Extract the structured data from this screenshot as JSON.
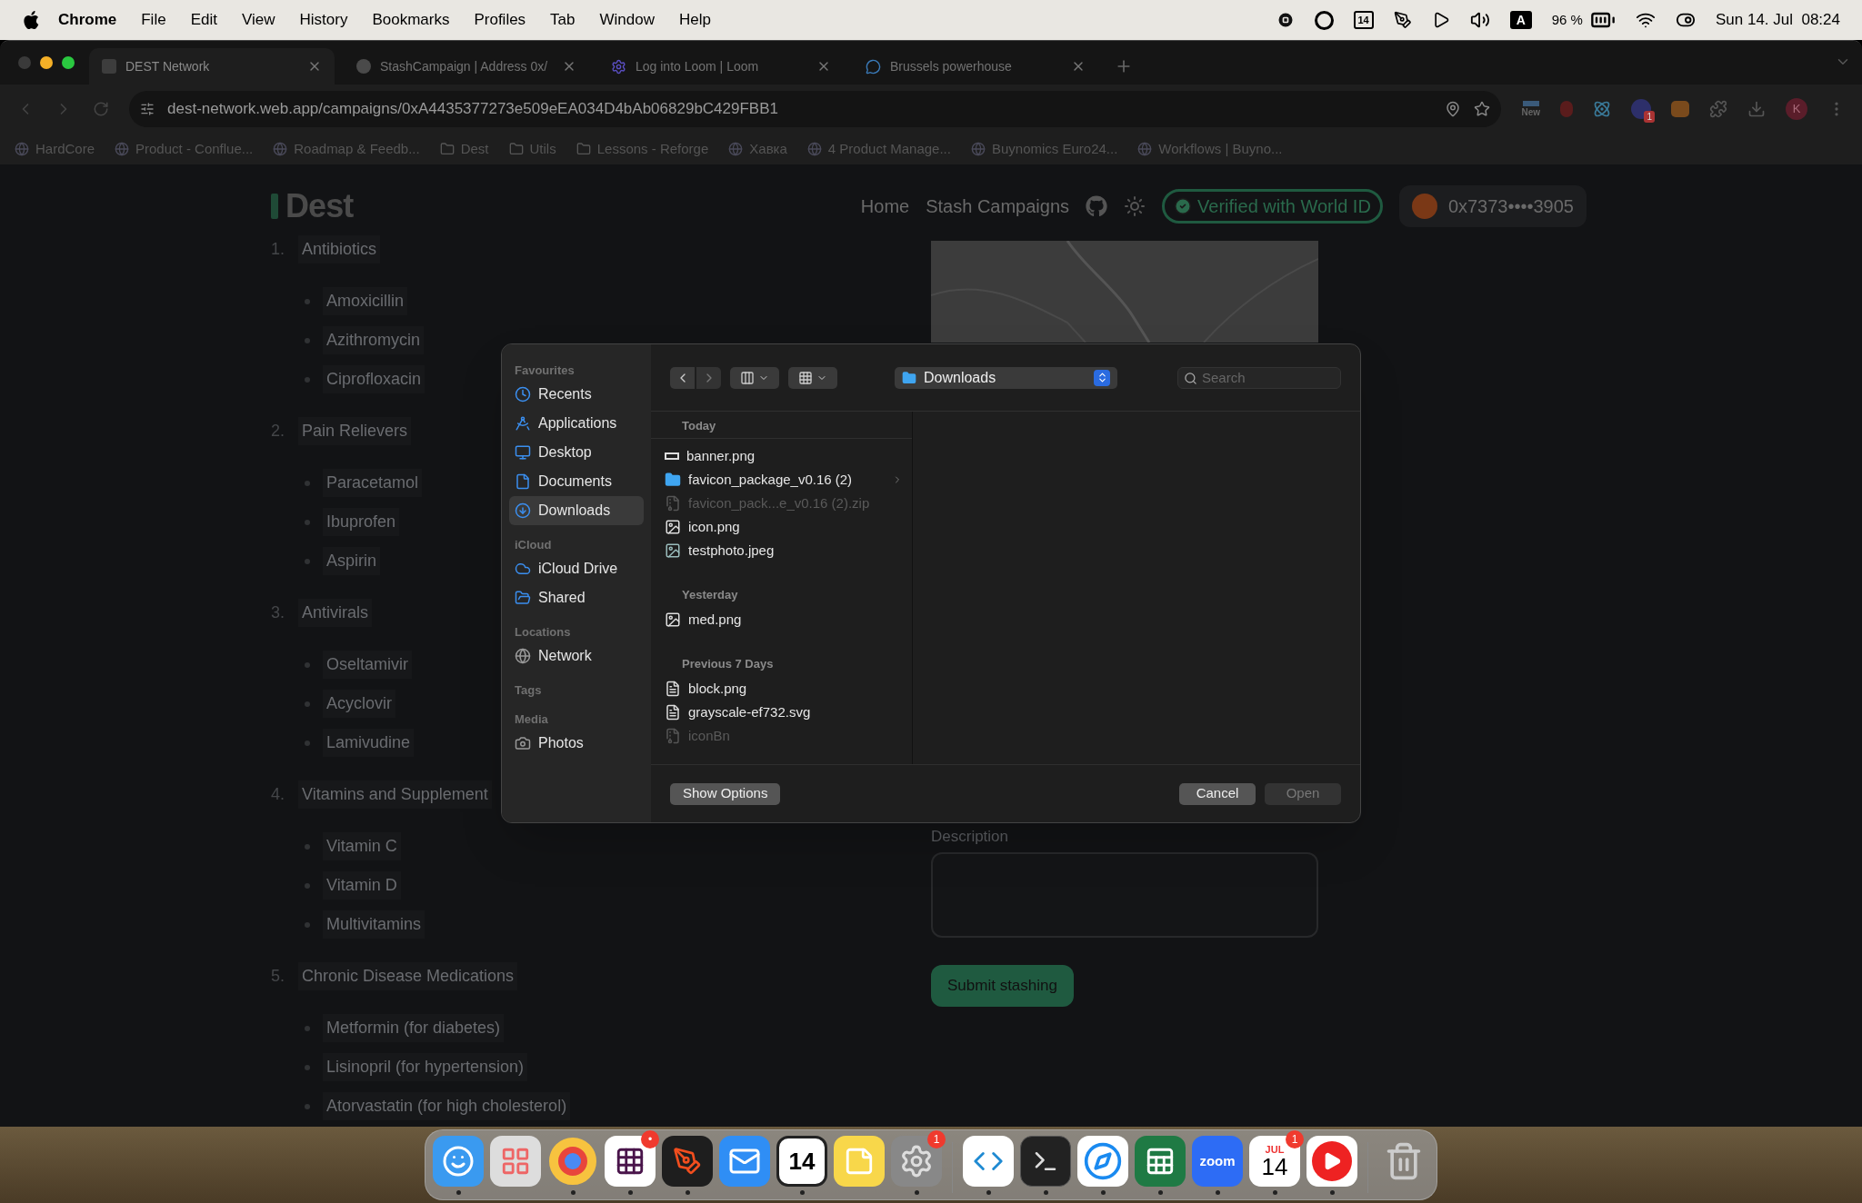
{
  "menu_bar": {
    "app": "Chrome",
    "items": [
      "File",
      "Edit",
      "View",
      "History",
      "Bookmarks",
      "Profiles",
      "Tab",
      "Window",
      "Help"
    ],
    "calendar_day": "14",
    "input_source": "A",
    "battery": "96 %",
    "clock": "Sun 14. Jul  08:24"
  },
  "browser": {
    "tabs": [
      {
        "title": "DEST Network",
        "selected": true
      },
      {
        "title": "StashCampaign | Address 0x/",
        "selected": false
      },
      {
        "title": "Log into Loom | Loom",
        "selected": false
      },
      {
        "title": "Brussels powerhouse",
        "selected": false
      }
    ],
    "url": "dest-network.web.app/campaigns/0xA4435377273e509eEA034D4bAb06829bC429FBB1",
    "extension_new": "New",
    "extension_badge": "1",
    "profile_initial": "K",
    "bookmarks": [
      {
        "label": "HardCore",
        "kind": "site"
      },
      {
        "label": "Product - Conflue...",
        "kind": "site"
      },
      {
        "label": "Roadmap & Feedb...",
        "kind": "site"
      },
      {
        "label": "Dest",
        "kind": "folder"
      },
      {
        "label": "Utils",
        "kind": "folder"
      },
      {
        "label": "Lessons - Reforge",
        "kind": "folder"
      },
      {
        "label": "Хавка",
        "kind": "site"
      },
      {
        "label": "4 Product Manage...",
        "kind": "site"
      },
      {
        "label": "Buynomics Euro24...",
        "kind": "site"
      },
      {
        "label": "Workflows | Buyno...",
        "kind": "site"
      }
    ]
  },
  "page": {
    "logo": "Dest",
    "nav": [
      "Home",
      "Stash Campaigns"
    ],
    "verified": "Verified with World ID",
    "wallet": "0x7373••••3905",
    "categories": [
      {
        "number": "1.",
        "title": "Antibiotics",
        "items": [
          "Amoxicillin",
          "Azithromycin",
          "Ciprofloxacin"
        ]
      },
      {
        "number": "2.",
        "title": "Pain Relievers",
        "items": [
          "Paracetamol",
          "Ibuprofen",
          "Aspirin"
        ]
      },
      {
        "number": "3.",
        "title": "Antivirals",
        "items": [
          "Oseltamivir",
          "Acyclovir",
          "Lamivudine"
        ]
      },
      {
        "number": "4.",
        "title": "Vitamins and Supplement",
        "items": [
          "Vitamin C",
          "Vitamin D",
          "Multivitamins"
        ]
      },
      {
        "number": "5.",
        "title": "Chronic Disease Medications",
        "items": [
          "Metformin (for diabetes)",
          "Lisinopril (for hypertension)",
          "Atorvastatin (for high cholesterol)"
        ]
      }
    ],
    "description_label": "Description",
    "submit": "Submit stashing"
  },
  "dialog": {
    "sections": [
      {
        "heading": "Favourites",
        "items": [
          {
            "label": "Recents",
            "selected": false
          },
          {
            "label": "Applications",
            "selected": false
          },
          {
            "label": "Desktop",
            "selected": false
          },
          {
            "label": "Documents",
            "selected": false
          },
          {
            "label": "Downloads",
            "selected": true
          }
        ]
      },
      {
        "heading": "iCloud",
        "items": [
          {
            "label": "iCloud Drive",
            "selected": false
          },
          {
            "label": "Shared",
            "selected": false
          }
        ]
      },
      {
        "heading": "Locations",
        "items": [
          {
            "label": "Network",
            "selected": false
          }
        ]
      },
      {
        "heading": "Tags"
      },
      {
        "heading": "Media",
        "items": [
          {
            "label": "Photos",
            "selected": false
          }
        ]
      }
    ],
    "location": "Downloads",
    "search_placeholder": "Search",
    "groups": [
      {
        "heading": "Today",
        "files": [
          {
            "name": "banner.png",
            "kind": "banner",
            "disabled": false
          },
          {
            "name": "favicon_package_v0.16 (2)",
            "kind": "folder",
            "disabled": false
          },
          {
            "name": "favicon_pack...e_v0.16 (2).zip",
            "kind": "archive",
            "disabled": true
          },
          {
            "name": "icon.png",
            "kind": "image",
            "disabled": false
          },
          {
            "name": "testphoto.jpeg",
            "kind": "photo",
            "disabled": false
          }
        ]
      },
      {
        "heading": "Yesterday",
        "files": [
          {
            "name": "med.png",
            "kind": "image",
            "disabled": false
          }
        ]
      },
      {
        "heading": "Previous 7 Days",
        "files": [
          {
            "name": "block.png",
            "kind": "document",
            "disabled": false
          },
          {
            "name": "grayscale-ef732.svg",
            "kind": "document",
            "disabled": false
          },
          {
            "name": "iconBn",
            "kind": "archive",
            "disabled": true
          }
        ]
      }
    ],
    "options_button": "Show Options",
    "cancel": {
      "label": "Cancel",
      "disabled": false
    },
    "open": {
      "label": "Open",
      "disabled": true
    }
  },
  "dock": [
    {
      "kind": "finder",
      "running": true
    },
    {
      "kind": "launchpad",
      "running": false
    },
    {
      "kind": "chrome",
      "running": true
    },
    {
      "kind": "slack",
      "running": true,
      "badge": "•"
    },
    {
      "kind": "figma",
      "running": true
    },
    {
      "kind": "mail",
      "running": false
    },
    {
      "kind": "day",
      "running": true,
      "text": "14"
    },
    {
      "kind": "notes",
      "running": false
    },
    {
      "kind": "settings",
      "running": true,
      "badge": "1"
    },
    {
      "kind": "divider"
    },
    {
      "kind": "code",
      "running": true
    },
    {
      "kind": "terminal",
      "running": true
    },
    {
      "kind": "safari",
      "running": true
    },
    {
      "kind": "excel",
      "running": true
    },
    {
      "kind": "zoom",
      "running": true,
      "text": "zoom"
    },
    {
      "kind": "calendar",
      "running": true,
      "text": "14",
      "month": "JUL",
      "badge": "1"
    },
    {
      "kind": "player",
      "running": true
    },
    {
      "kind": "divider"
    },
    {
      "kind": "trash",
      "running": false
    }
  ]
}
